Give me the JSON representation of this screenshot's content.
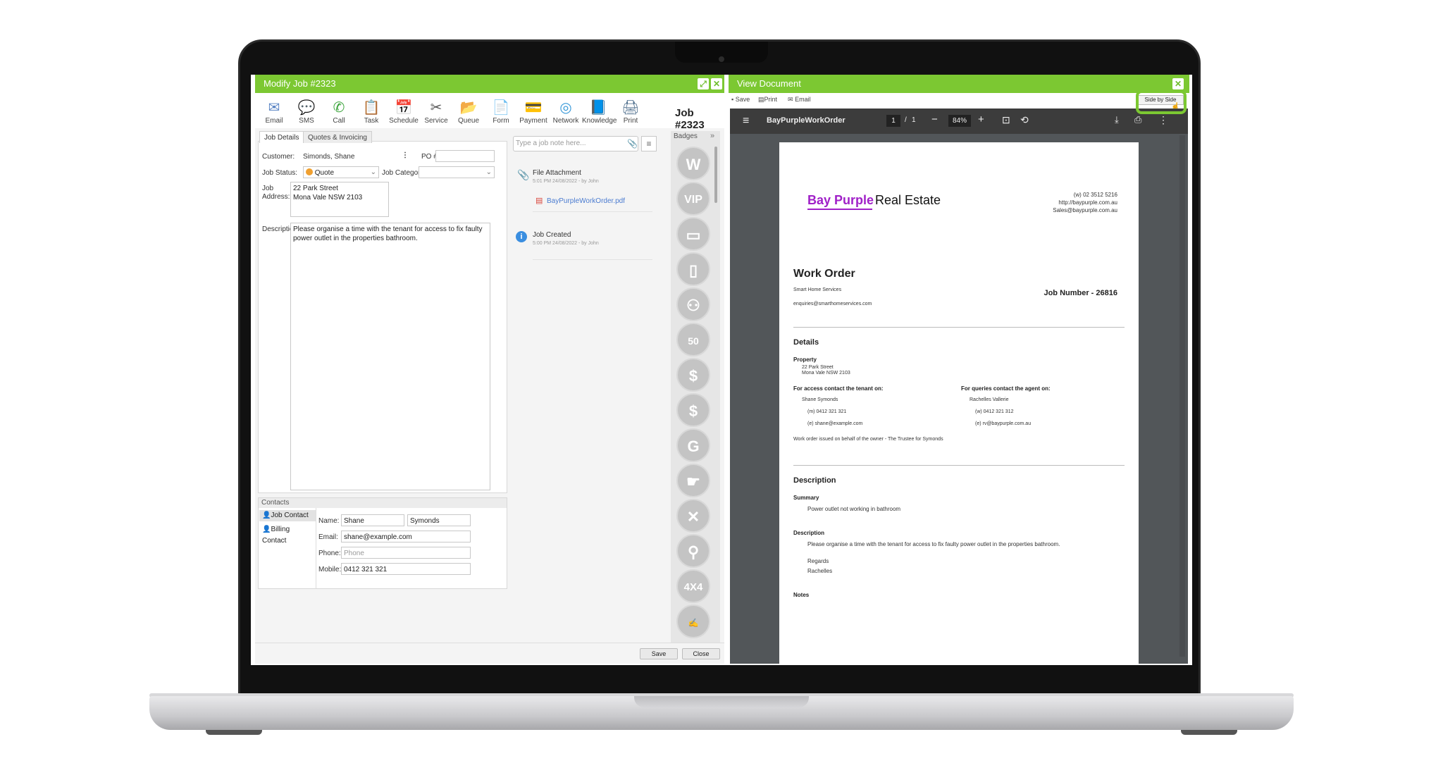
{
  "left_window": {
    "title": "Modify Job #2323",
    "toolbar": [
      "Email",
      "SMS",
      "Call",
      "Task",
      "Schedule",
      "Service",
      "Queue",
      "Form",
      "Payment",
      "Network",
      "Knowledge",
      "Print"
    ],
    "job_heading": "Job #2323",
    "tabs": [
      "Job Details",
      "Quotes & Invoicing"
    ],
    "customer_label": "Customer:",
    "customer_value": "Simonds, Shane",
    "po_label": "PO #",
    "status_label": "Job Status:",
    "status_value": "Quote",
    "category_label": "Job Category",
    "address_label_1": "Job",
    "address_label_2": "Address:",
    "address_line1": "22 Park Street",
    "address_line2": "Mona Vale NSW 2103",
    "description_label": "Description:",
    "description_value": "Please organise a time with the tenant for access to fix faulty power outlet in the properties bathroom.",
    "contacts": {
      "header": "Contacts",
      "items": [
        "Job Contact",
        "Billing Contact"
      ],
      "name_label": "Name:",
      "first_name": "Shane",
      "last_name": "Symonds",
      "email_label": "Email:",
      "email": "shane@example.com",
      "phone_label": "Phone:",
      "phone_placeholder": "Phone",
      "mobile_label": "Mobile:",
      "mobile": "0412 321 321"
    },
    "note_placeholder": "Type a job note here...",
    "timeline": [
      {
        "title": "File Attachment",
        "meta": "5:01 PM 24/08/2022 - by John",
        "file": "BayPurpleWorkOrder.pdf"
      },
      {
        "title": "Job Created",
        "meta": "5:00 PM 24/08/2022 - by John"
      }
    ],
    "badges_label": "Badges",
    "badges": [
      "W",
      "VIP",
      "card",
      "phone",
      "people",
      "50",
      "$",
      "$",
      "G",
      "hand",
      "X",
      "pin",
      "4X4",
      "sig"
    ],
    "save_button": "Save",
    "close_button": "Close"
  },
  "right_window": {
    "title": "View Document",
    "actions": [
      "Save",
      "Print",
      "Email"
    ],
    "side_by_side": "Side by Side",
    "pdf": {
      "filename": "BayPurpleWorkOrder",
      "page_current": "1",
      "page_sep": "/",
      "page_total": "1",
      "zoom": "84%"
    }
  },
  "document": {
    "brand_1": "Bay Purple",
    "brand_2": "Real Estate",
    "contact_phone": "(w) 02 3512 5216",
    "contact_web": "http://baypurple.com.au",
    "contact_email": "Sales@baypurple.com.au",
    "heading": "Work Order",
    "company": "Smart Home Services",
    "company_email": "enquiries@smarthomeservices.com",
    "job_number": "Job Number - 26816",
    "details": "Details",
    "property_label": "Property",
    "property_line1": "22 Park Street",
    "property_line2": "Mona Vale NSW 2103",
    "tenant_label": "For access contact the tenant on:",
    "tenant_name": "Shane Symonds",
    "tenant_mobile": "(m) 0412 321 321",
    "tenant_email": "(e) shane@example.com",
    "agent_label": "For queries contact the agent on:",
    "agent_name": "Rachelles Vallerie",
    "agent_phone": "(w) 0412 321 312",
    "agent_email": "(e) rv@baypurple.com.au",
    "issued": "Work order issued on behalf of the owner - The Trustee for Symonds",
    "description_heading": "Description",
    "summary_label": "Summary",
    "summary": "Power outlet not working in bathroom",
    "desc_label": "Description",
    "desc": "Please organise a time with the tenant for access to fix faulty power outlet in the properties bathroom.",
    "regards": "Regards",
    "signoff": "Rachelles",
    "notes": "Notes"
  },
  "colors": {
    "accent": "#7cc832",
    "brand": "#a020c8",
    "pdf_toolbar": "#3c3c3c",
    "pdf_bg": "#525659"
  }
}
